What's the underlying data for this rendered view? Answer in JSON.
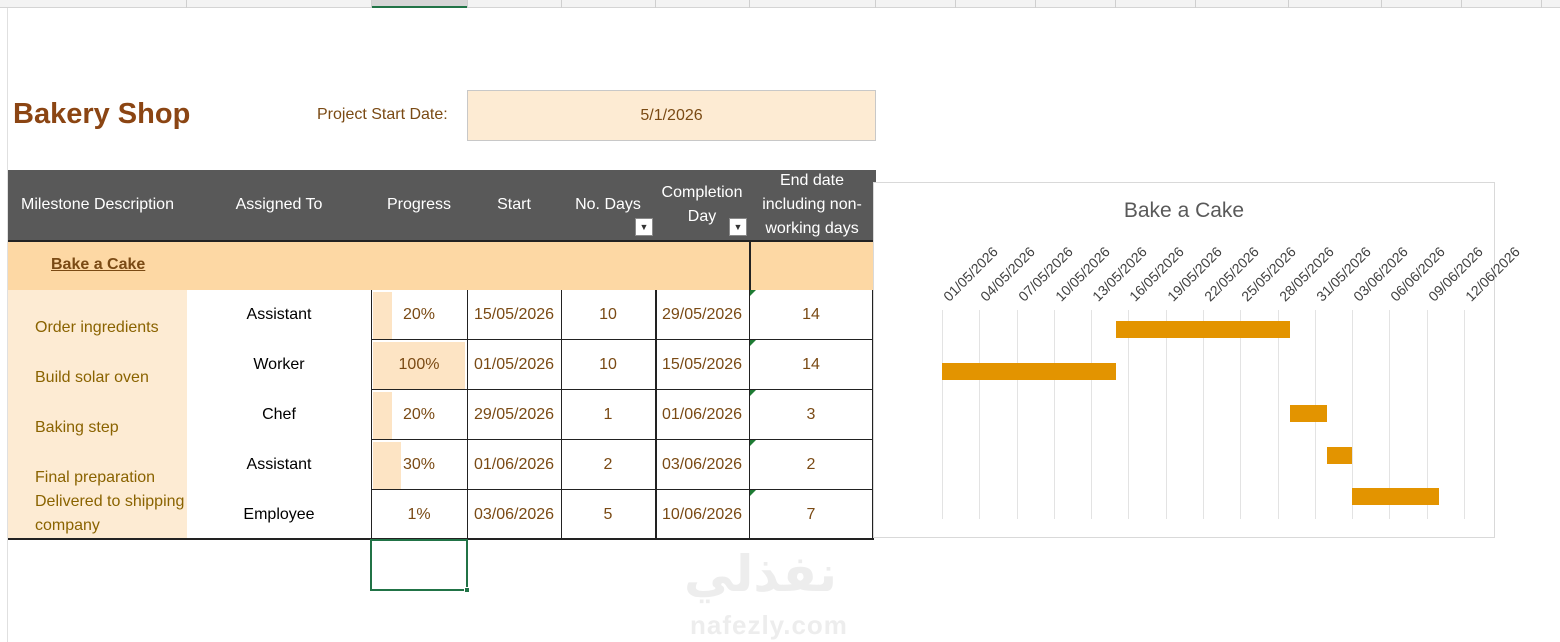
{
  "sheet": {
    "title": "Bakery Shop",
    "project_start_label": "Project Start Date:",
    "project_start_value": "5/1/2026"
  },
  "table": {
    "headers": {
      "milestone": "Milestone Description",
      "assigned": "Assigned To",
      "progress": "Progress",
      "start": "Start",
      "days": "No. Days",
      "completion": "Completion Day",
      "enddate": "End date including non-working days"
    },
    "group": "Bake a Cake",
    "rows": [
      {
        "milestone": "Order ingredients",
        "assigned": "Assistant",
        "progress": "20%",
        "progress_fraction": 0.2,
        "start": "15/05/2026",
        "days": "10",
        "completion": "29/05/2026",
        "enddate": "14"
      },
      {
        "milestone": "Build solar oven",
        "assigned": "Worker",
        "progress": "100%",
        "progress_fraction": 1.0,
        "start": "01/05/2026",
        "days": "10",
        "completion": "15/05/2026",
        "enddate": "14"
      },
      {
        "milestone": "Baking step",
        "assigned": "Chef",
        "progress": "20%",
        "progress_fraction": 0.2,
        "start": "29/05/2026",
        "days": "1",
        "completion": "01/06/2026",
        "enddate": "3"
      },
      {
        "milestone": "Final preparation",
        "assigned": "Assistant",
        "progress": "30%",
        "progress_fraction": 0.3,
        "start": "01/06/2026",
        "days": "2",
        "completion": "03/06/2026",
        "enddate": "2"
      },
      {
        "milestone": "Delivered to shipping company",
        "assigned": "Employee",
        "progress": "1%",
        "progress_fraction": 0.01,
        "start": "03/06/2026",
        "days": "5",
        "completion": "10/06/2026",
        "enddate": "7"
      }
    ]
  },
  "colors": {
    "header_bg": "#595959",
    "group_bg": "#fdd8a4",
    "milestone_bg": "#fdebd3",
    "bar": "#e39400",
    "selection": "#217346"
  },
  "watermark": {
    "arabic": "نفذلي",
    "latin": "nafezly.com"
  },
  "chart_data": {
    "type": "bar",
    "title": "Bake a Cake",
    "x_tick_labels": [
      "01/05/2026",
      "04/05/2026",
      "07/05/2026",
      "10/05/2026",
      "13/05/2026",
      "16/05/2026",
      "19/05/2026",
      "22/05/2026",
      "25/05/2026",
      "28/05/2026",
      "31/05/2026",
      "03/06/2026",
      "06/06/2026",
      "09/06/2026",
      "12/06/2026"
    ],
    "xlim": [
      "2026-05-01",
      "2026-06-12"
    ],
    "orientation": "horizontal",
    "series": [
      {
        "values": [
          {
            "start": "2026-05-15",
            "end": "2026-05-29"
          },
          {
            "start": "2026-05-01",
            "end": "2026-05-15"
          },
          {
            "start": "2026-05-29",
            "end": "2026-06-01"
          },
          {
            "start": "2026-06-01",
            "end": "2026-06-03"
          },
          {
            "start": "2026-06-03",
            "end": "2026-06-10"
          }
        ]
      }
    ],
    "grid": true,
    "legend": "none"
  }
}
